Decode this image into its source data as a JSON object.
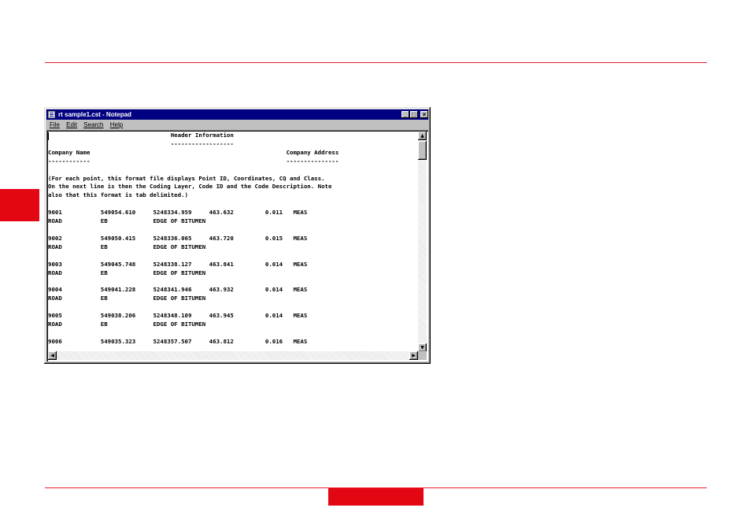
{
  "window": {
    "title": "rt sample1.cst - Notepad",
    "controls": {
      "minimize": "_",
      "maximize": "□",
      "close": "×"
    }
  },
  "menu": [
    "File",
    "Edit",
    "Search",
    "Help"
  ],
  "document_lines": [
    "                                   Header Information",
    "                                   ------------------",
    "Company Name                                                        Company Address",
    "------------                                                        ---------------",
    "",
    "(For each point, this format file displays Point ID, Coordinates, CQ and Class.",
    "On the next line is then the Coding Layer, Code ID and the Code Description. Note",
    "also that this format is tab delimited.)",
    "",
    "9001           549054.610     5248334.959     463.632         0.011   MEAS",
    "ROAD           EB             EDGE OF BITUMEN",
    "",
    "9002           549050.415     5248336.065     463.720         0.015   MEAS",
    "ROAD           EB             EDGE OF BITUMEN",
    "",
    "9003           549045.748     5248338.127     463.841         0.014   MEAS",
    "ROAD           EB             EDGE OF BITUMEN",
    "",
    "9004           549041.228     5248341.946     463.932         0.014   MEAS",
    "ROAD           EB             EDGE OF BITUMEN",
    "",
    "9005           549038.206     5248348.109     463.945         0.014   MEAS",
    "ROAD           EB             EDGE OF BITUMEN",
    "",
    "9006           549035.323     5248357.507     463.812         0.016   MEAS"
  ],
  "scroll_arrows": {
    "up": "▲",
    "down": "▼",
    "left": "◀",
    "right": "▶"
  },
  "colors": {
    "accent_red": "#e30613",
    "titlebar": "#000080",
    "window_face": "#c0c0c0"
  }
}
